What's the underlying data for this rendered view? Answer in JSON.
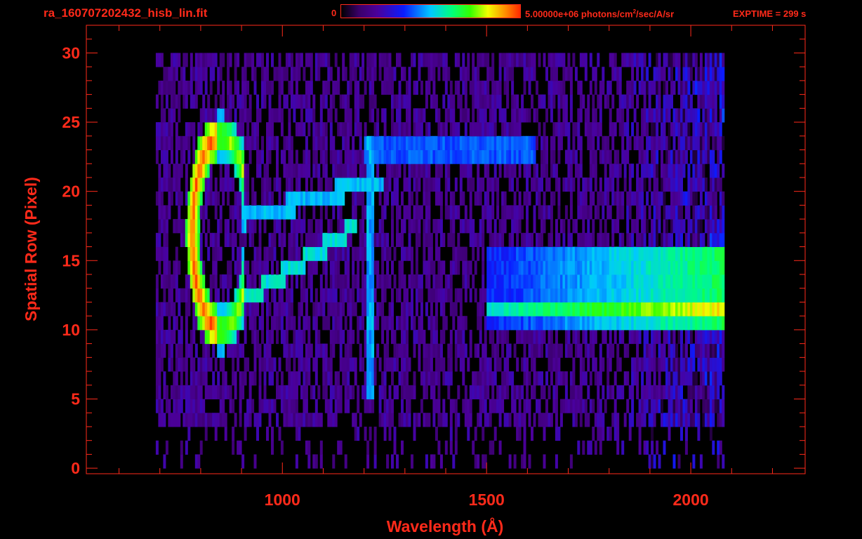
{
  "header": {
    "filename": "ra_160707202432_hisb_lin.fit",
    "colorbar_min": "0",
    "colorbar_max_prefix": "5.00000e+06 photons/cm",
    "colorbar_max_sup": "2",
    "colorbar_max_suffix": "/sec/A/sr",
    "exptime": "EXPTIME = 299 s"
  },
  "colors": {
    "axis": "#ff2a1a",
    "background": "#000000"
  },
  "chart_data": {
    "type": "heatmap",
    "xlabel": "Wavelength (Å)",
    "ylabel": "Spatial Row (Pixel)",
    "xlim": [
      520,
      2280
    ],
    "ylim": [
      -0.4,
      32
    ],
    "xticks": [
      1000,
      1500,
      2000
    ],
    "yticks": [
      0,
      5,
      10,
      15,
      20,
      25,
      30
    ],
    "zlim": [
      0,
      5000000
    ],
    "zunit": "photons/cm2/sec/A/sr",
    "grid": false,
    "colormap": "rainbow",
    "data_extent": {
      "x": [
        690,
        2080
      ],
      "y": [
        0,
        30
      ]
    },
    "features": [
      {
        "name": "bright arc",
        "x_range": [
          770,
          900
        ],
        "y_range": [
          10,
          24
        ],
        "level": "high"
      },
      {
        "name": "tail band upper",
        "x_from": 900,
        "x_to": 1500,
        "y_from": 18,
        "y_to": 22.5,
        "level": "medium"
      },
      {
        "name": "tail band lower",
        "x_from": 900,
        "x_to": 1180,
        "y_from": 12,
        "y_to": 17,
        "level": "medium"
      },
      {
        "name": "emission line",
        "x": 1216,
        "y_range": [
          5,
          24
        ],
        "level": "medium"
      },
      {
        "name": "upper stripe",
        "x_range": [
          1200,
          1620
        ],
        "y_range": [
          22.5,
          23.8
        ],
        "level": "medium"
      },
      {
        "name": "long-wavelength band",
        "x_range": [
          1500,
          2070
        ],
        "y_range": [
          10,
          16
        ],
        "level": "high"
      }
    ]
  }
}
